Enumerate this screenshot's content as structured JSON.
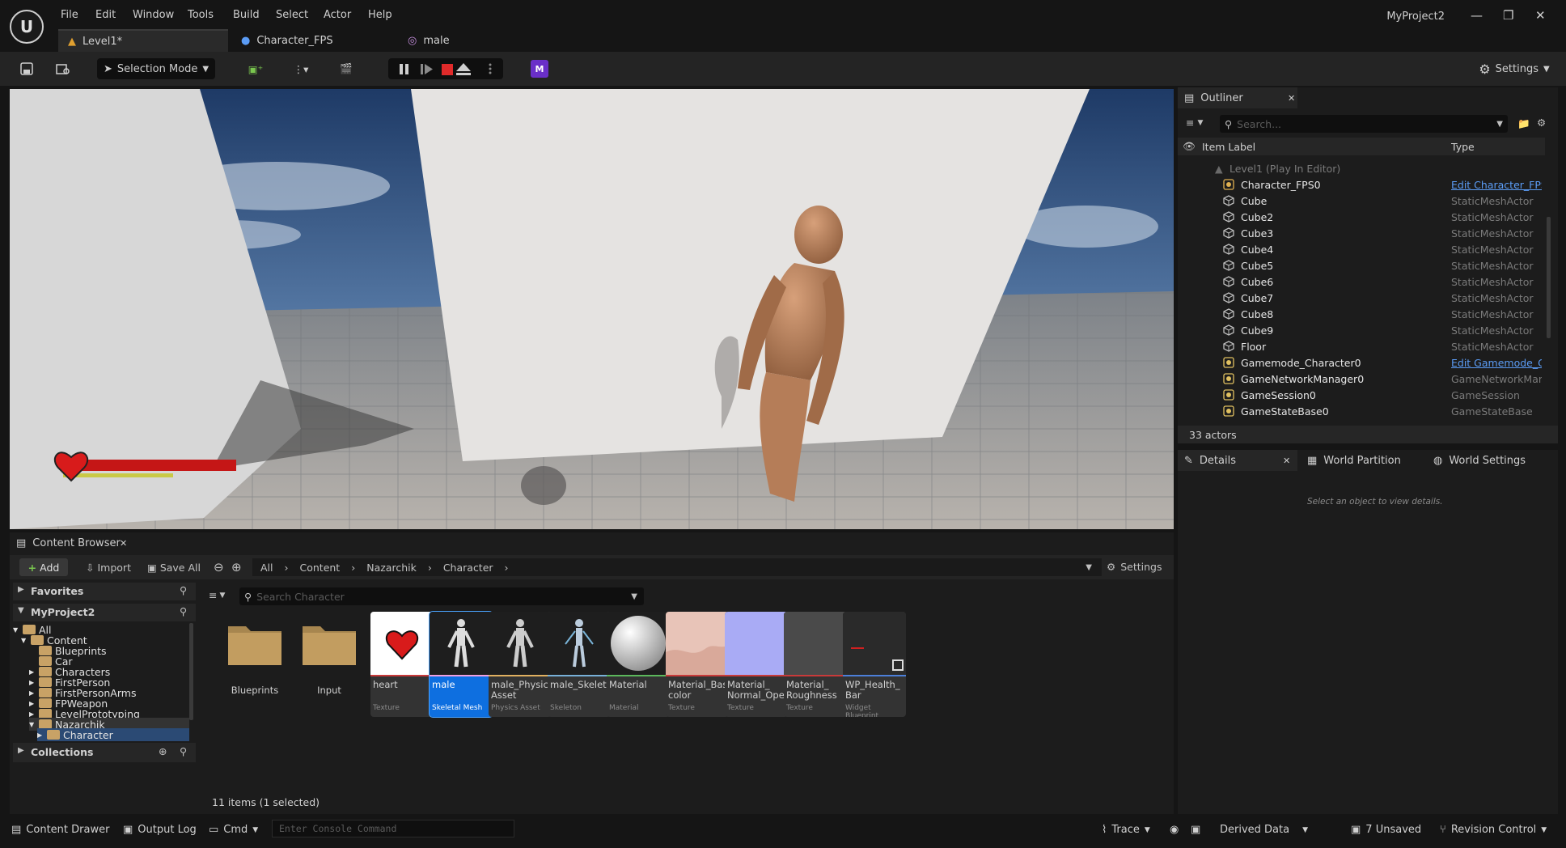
{
  "menu": [
    "File",
    "Edit",
    "Window",
    "Tools",
    "Build",
    "Select",
    "Actor",
    "Help"
  ],
  "project_name": "MyProject2",
  "doc_tabs": {
    "level": "Level1*",
    "character": "Character_FPS",
    "male": "male"
  },
  "toolbar": {
    "selection_mode": "Selection Mode",
    "settings": "Settings"
  },
  "outliner": {
    "tab": "Outliner",
    "search_placeholder": "Search...",
    "col_label": "Item Label",
    "col_type": "Type",
    "level_row": "Level1 (Play In Editor)",
    "rows": [
      {
        "label": "Character_FPS0",
        "type": "Edit Character_FPS",
        "link": true,
        "icon": "pawn-icon"
      },
      {
        "label": "Cube",
        "type": "StaticMeshActor",
        "icon": "static-mesh-icon"
      },
      {
        "label": "Cube2",
        "type": "StaticMeshActor",
        "icon": "static-mesh-icon"
      },
      {
        "label": "Cube3",
        "type": "StaticMeshActor",
        "icon": "static-mesh-icon"
      },
      {
        "label": "Cube4",
        "type": "StaticMeshActor",
        "icon": "static-mesh-icon"
      },
      {
        "label": "Cube5",
        "type": "StaticMeshActor",
        "icon": "static-mesh-icon"
      },
      {
        "label": "Cube6",
        "type": "StaticMeshActor",
        "icon": "static-mesh-icon"
      },
      {
        "label": "Cube7",
        "type": "StaticMeshActor",
        "icon": "static-mesh-icon"
      },
      {
        "label": "Cube8",
        "type": "StaticMeshActor",
        "icon": "static-mesh-icon"
      },
      {
        "label": "Cube9",
        "type": "StaticMeshActor",
        "icon": "static-mesh-icon"
      },
      {
        "label": "Floor",
        "type": "StaticMeshActor",
        "icon": "static-mesh-icon"
      },
      {
        "label": "Gamemode_Character0",
        "type": "Edit Gamemode_Ch",
        "link": true,
        "icon": "gamemode-icon"
      },
      {
        "label": "GameNetworkManager0",
        "type": "GameNetworkMana",
        "icon": "info-icon"
      },
      {
        "label": "GameSession0",
        "type": "GameSession",
        "icon": "info-icon"
      },
      {
        "label": "GameStateBase0",
        "type": "GameStateBase",
        "icon": "gamemode-icon"
      }
    ],
    "actor_count": "33 actors"
  },
  "details": {
    "tab": "Details",
    "world_partition": "World Partition",
    "world_settings": "World Settings",
    "empty_text": "Select an object to view details."
  },
  "content_browser": {
    "tab": "Content Browser",
    "add": "Add",
    "import": "Import",
    "save_all": "Save All",
    "breadcrumb": [
      "All",
      "Content",
      "Nazarchik",
      "Character"
    ],
    "settings": "Settings",
    "favorites": "Favorites",
    "project": "MyProject2",
    "collections": "Collections",
    "search_placeholder": "Search Character",
    "tree": [
      "All",
      "Content",
      "Blueprints",
      "Car",
      "Characters",
      "FirstPerson",
      "FirstPersonArms",
      "FPWeapon",
      "LevelPrototyping",
      "Nazarchik",
      "Character"
    ],
    "folders": [
      "Blueprints",
      "Input"
    ],
    "assets": [
      {
        "name": "heart",
        "type": "Texture",
        "color": "#c93a3a"
      },
      {
        "name": "male",
        "type": "Skeletal Mesh",
        "color": "#f0a0e0"
      },
      {
        "name": "male_Physics Asset",
        "type": "Physics Asset",
        "color": "#e0b060"
      },
      {
        "name": "male_Skeleton",
        "type": "Skeleton",
        "color": "#78b0d8"
      },
      {
        "name": "Material",
        "type": "Material",
        "color": "#5cb85c"
      },
      {
        "name": "Material_Base_ color",
        "type": "Texture",
        "color": "#c93a3a"
      },
      {
        "name": "Material_ Normal_Open",
        "type": "Texture",
        "color": "#c93a3a"
      },
      {
        "name": "Material_ Roughness",
        "type": "Texture",
        "color": "#c93a3a"
      },
      {
        "name": "WP_Health_ Bar",
        "type": "Widget Blueprint",
        "color": "#4c7fd9"
      }
    ],
    "item_count": "11 items (1 selected)"
  },
  "statusbar": {
    "content_drawer": "Content Drawer",
    "output_log": "Output Log",
    "cmd": "Cmd",
    "console_placeholder": "Enter Console Command",
    "trace": "Trace",
    "derived_data": "Derived Data",
    "unsaved": "7 Unsaved",
    "revision_control": "Revision Control"
  },
  "hud": {
    "health_fraction": 0.82,
    "stamina_fraction": 0.6
  }
}
